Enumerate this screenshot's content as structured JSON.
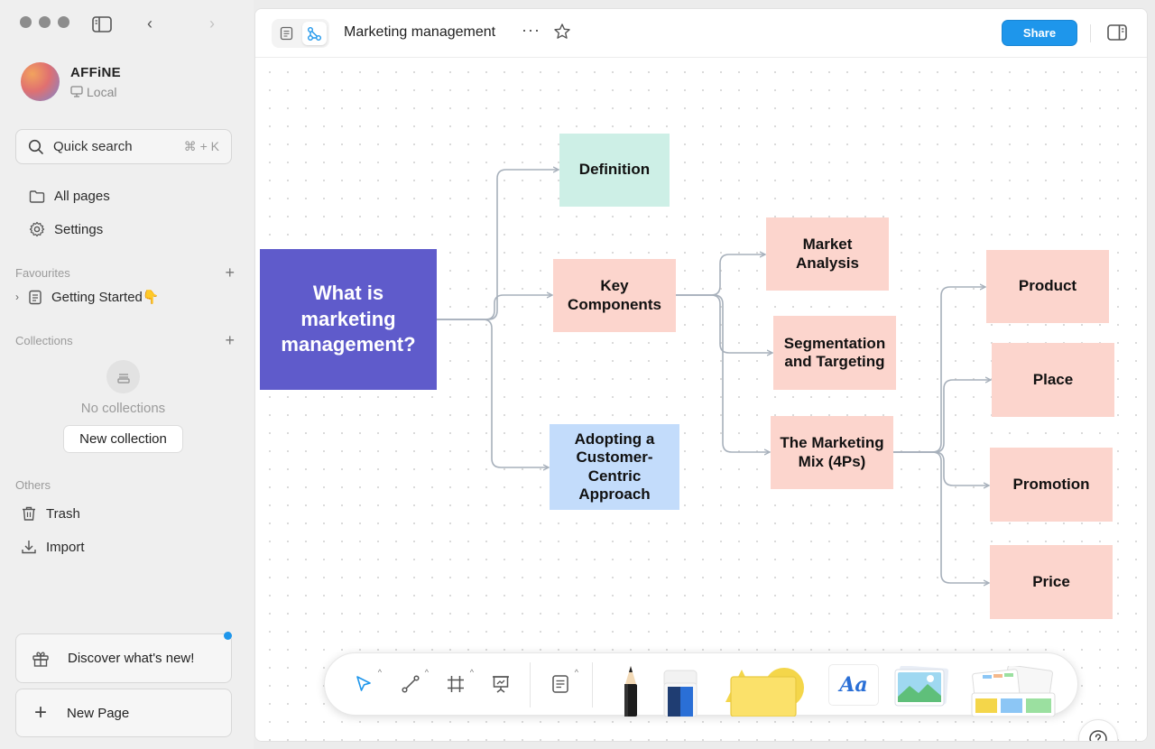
{
  "sidebar": {
    "workspace": {
      "name": "AFFiNE",
      "storage": "Local"
    },
    "search": {
      "label": "Quick search",
      "shortcut": "⌘ + K"
    },
    "nav": [
      {
        "label": "All pages",
        "icon": "folder-icon"
      },
      {
        "label": "Settings",
        "icon": "gear-icon"
      }
    ],
    "favourites": {
      "title": "Favourites",
      "items": [
        {
          "label": "Getting Started👇"
        }
      ]
    },
    "collections": {
      "title": "Collections",
      "empty_text": "No collections",
      "new_button": "New collection"
    },
    "others": {
      "title": "Others",
      "items": [
        {
          "label": "Trash",
          "icon": "trash-icon"
        },
        {
          "label": "Import",
          "icon": "import-icon"
        }
      ]
    },
    "discover_label": "Discover what's new!",
    "new_page_label": "New Page"
  },
  "header": {
    "title": "Marketing management",
    "share_label": "Share",
    "active_mode": "edgeless"
  },
  "diagram": {
    "nodes": {
      "root": "What is marketing management?",
      "definition": "Definition",
      "key_components": "Key Components",
      "customer_centric": "Adopting a Customer-Centric Approach",
      "market_analysis": "Market Analysis",
      "segmentation": "Segmentation and Targeting",
      "marketing_mix": "The Marketing Mix (4Ps)",
      "product": "Product",
      "place": "Place",
      "promotion": "Promotion",
      "price": "Price"
    },
    "edges": [
      [
        "root",
        "definition"
      ],
      [
        "root",
        "key_components"
      ],
      [
        "root",
        "customer_centric"
      ],
      [
        "key_components",
        "market_analysis"
      ],
      [
        "key_components",
        "segmentation"
      ],
      [
        "key_components",
        "marketing_mix"
      ],
      [
        "marketing_mix",
        "product"
      ],
      [
        "marketing_mix",
        "place"
      ],
      [
        "marketing_mix",
        "promotion"
      ],
      [
        "marketing_mix",
        "price"
      ]
    ]
  },
  "toolbar": {
    "tools": [
      "select",
      "connector",
      "frame",
      "presentation",
      "note"
    ],
    "text_tool_label": "Aa"
  },
  "colors": {
    "accent": "#1e96eb",
    "root_node": "#5f5bcb",
    "green_node": "#cdefe6",
    "pink_node": "#fcd5cd",
    "blue_node": "#c3dcfb",
    "connector": "#a7b0bb"
  }
}
